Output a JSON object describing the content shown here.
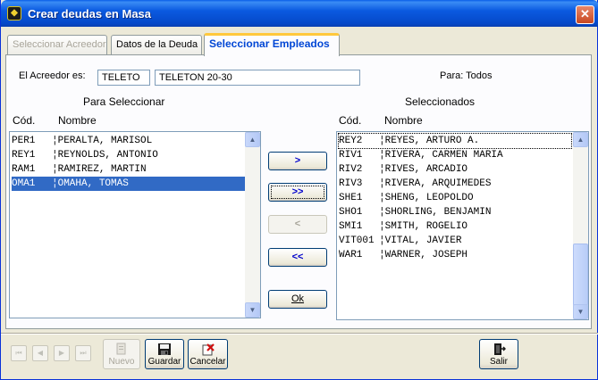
{
  "window": {
    "title": "Crear deudas en Masa",
    "close_glyph": "✕"
  },
  "tabs": [
    {
      "label": "Seleccionar Acreedor",
      "state": "disabled"
    },
    {
      "label": "Datos de la Deuda",
      "state": "normal"
    },
    {
      "label": "Seleccionar Empleados",
      "state": "active"
    }
  ],
  "creditor": {
    "label": "El Acreedor es:",
    "code": "TELETO",
    "name": "TELETON 20-30",
    "para_label": "Para: Todos"
  },
  "left_list": {
    "title": "Para Seleccionar",
    "col_code": "Cód.",
    "col_name": "Nombre",
    "rows": [
      {
        "code": "PER1",
        "name": "PERALTA, MARISOL"
      },
      {
        "code": "REY1",
        "name": "REYNOLDS, ANTONIO"
      },
      {
        "code": "RAM1",
        "name": "RAMIREZ, MARTIN"
      },
      {
        "code": "OMA1",
        "name": "OMAHA, TOMAS",
        "selected": true
      }
    ]
  },
  "right_list": {
    "title": "Seleccionados",
    "col_code": "Cód.",
    "col_name": "Nombre",
    "rows": [
      {
        "code": "REY2",
        "name": "REYES, ARTURO A.",
        "focused": true
      },
      {
        "code": "RIV1",
        "name": "RIVERA, CARMEN MARIA"
      },
      {
        "code": "RIV2",
        "name": "RIVES, ARCADIO"
      },
      {
        "code": "RIV3",
        "name": "RIVERA, ARQUIMEDES"
      },
      {
        "code": "SHE1",
        "name": "SHENG, LEOPOLDO"
      },
      {
        "code": "SHO1",
        "name": "SHORLING, BENJAMIN"
      },
      {
        "code": "SMI1",
        "name": "SMITH, ROGELIO"
      },
      {
        "code": "VIT001",
        "name": "VITAL, JAVIER"
      },
      {
        "code": "WAR1",
        "name": "WARNER, JOSEPH"
      }
    ]
  },
  "move_buttons": {
    "add_one": ">",
    "add_all": ">>",
    "remove_one": "<",
    "remove_all": "<<",
    "ok": "Ok"
  },
  "nav_buttons": {
    "first": "⏮",
    "prev": "◀",
    "next": "▶",
    "last": "⏭"
  },
  "toolbar": {
    "nuevo": "Nuevo",
    "guardar": "Guardar",
    "cancelar": "Cancelar",
    "salir": "Salir"
  },
  "scroll_glyphs": {
    "up": "▲",
    "down": "▼"
  }
}
